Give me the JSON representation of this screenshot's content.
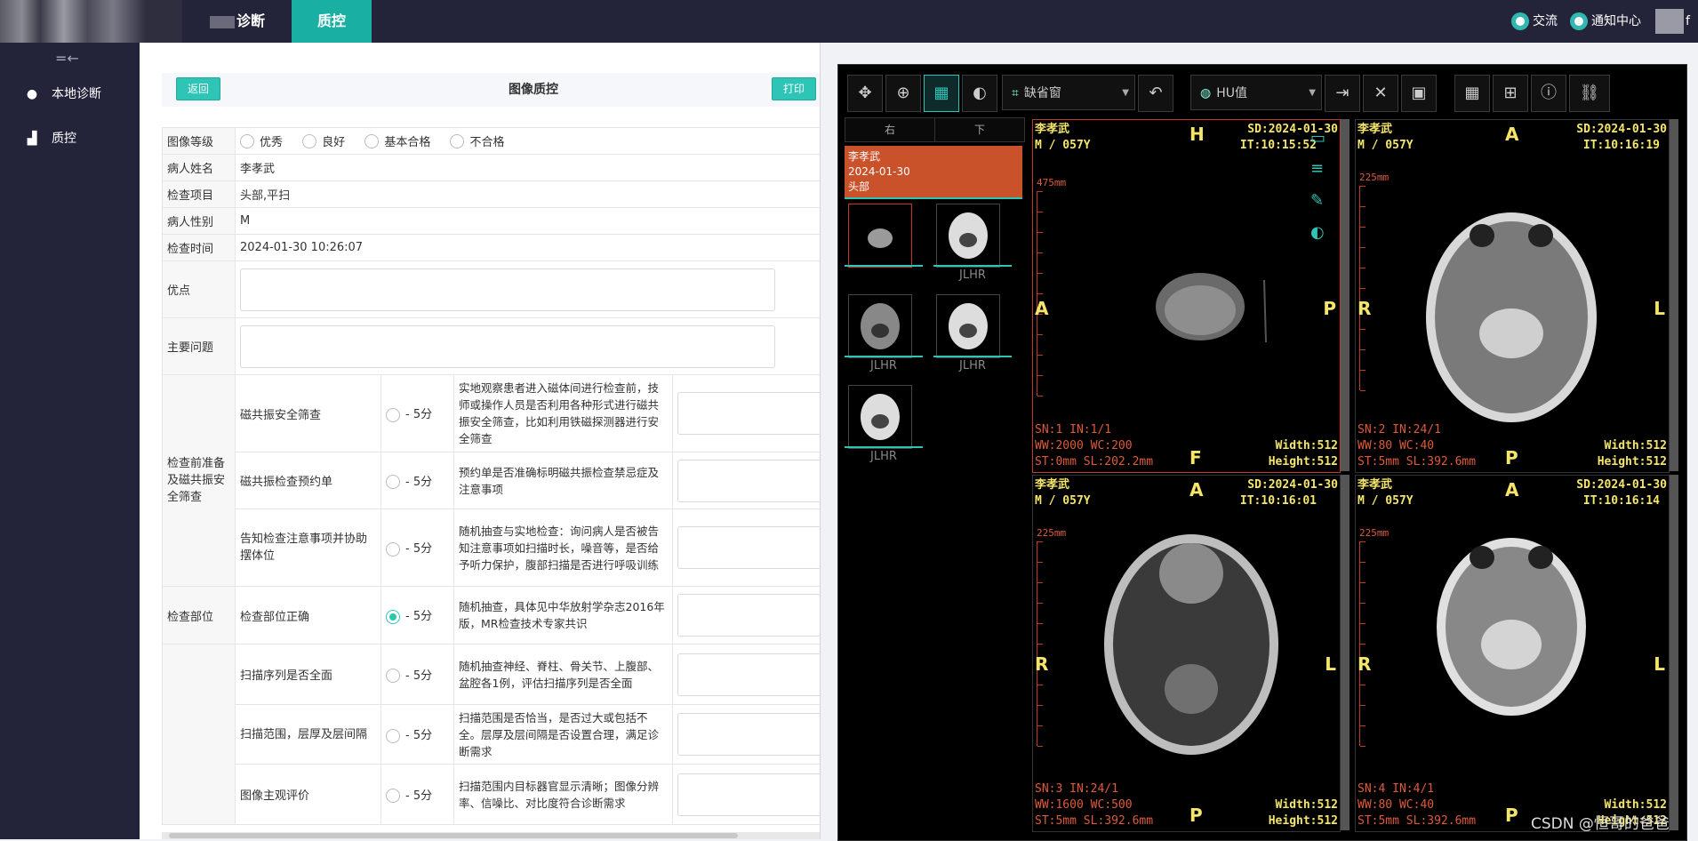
{
  "topbar": {
    "tabs": [
      "诊断",
      "质控"
    ],
    "exchange_label": "交流",
    "notify_label": "通知中心",
    "user_suffix": "f"
  },
  "sidebar": {
    "items": [
      {
        "label": "本地诊断",
        "icon": "user-icon"
      },
      {
        "label": "质控",
        "icon": "sitemap-icon"
      }
    ]
  },
  "form": {
    "title": "图像质控",
    "back_label": "返回",
    "print_label": "打印",
    "grade_label": "图像等级",
    "grade_options": [
      "优秀",
      "良好",
      "基本合格",
      "不合格"
    ],
    "patient_name_label": "病人姓名",
    "patient_name": "李孝武",
    "exam_item_label": "检查项目",
    "exam_item": "头部,平扫",
    "sex_label": "病人性别",
    "sex": "M",
    "exam_time_label": "检查时间",
    "exam_time": "2024-01-30 10:26:07",
    "merit_label": "优点",
    "problem_label": "主要问题",
    "groups": [
      {
        "name": "检查前准备及磁共振安全筛查",
        "rows": [
          {
            "item": "磁共振安全筛查",
            "score": "- 5分",
            "checked": false,
            "desc": "实地观察患者进入磁体间进行检查前，技师或操作人员是否利用各种形式进行磁共振安全筛查，比如利用铁磁探测器进行安全筛查"
          },
          {
            "item": "磁共振检查预约单",
            "score": "- 5分",
            "checked": false,
            "desc": "预约单是否准确标明磁共振检查禁忌症及注意事项"
          },
          {
            "item": "告知检查注意事项并协助摆体位",
            "score": "- 5分",
            "checked": false,
            "desc": "随机抽查与实地检查：询问病人是否被告知注意事项如扫描时长，噪音等，是否给予听力保护，腹部扫描是否进行呼吸训练"
          }
        ]
      },
      {
        "name": "检查部位",
        "rows": [
          {
            "item": "检查部位正确",
            "score": "- 5分",
            "checked": true,
            "desc": "随机抽查，具体见中华放射学杂志2016年版，MR检查技术专家共识"
          }
        ]
      },
      {
        "name": "",
        "rows": [
          {
            "item": "扫描序列是否全面",
            "score": "- 5分",
            "checked": false,
            "desc": "随机抽查神经、脊柱、骨关节、上腹部、盆腔各1例，评估扫描序列是否全面"
          },
          {
            "item": "扫描范围，层厚及层间隔",
            "score": "- 5分",
            "checked": false,
            "desc": "扫描范围是否恰当，是否过大或包括不全。层厚及层间隔是否设置合理，满足诊断需求"
          },
          {
            "item": "图像主观评价",
            "score": "- 5分",
            "checked": false,
            "desc": "扫描范围内目标器官显示清晰；图像分辨率、信噪比、对比度符合诊断需求"
          }
        ]
      }
    ]
  },
  "viewer": {
    "window_select": "缺省窗",
    "hu_select": "HU值",
    "series_tabs": [
      "右",
      "下"
    ],
    "patient_card": {
      "name": "李孝武",
      "date": "2024-01-30",
      "part": "头部"
    },
    "thumb_label": "JLHR",
    "viewports": [
      {
        "name": "李孝武",
        "sexage": "M / 057Y",
        "sd": "SD:2024-01-30",
        "it": "IT:10:15:52",
        "ruler": "475mm",
        "top": "H",
        "bottom": "F",
        "left": "A",
        "right": "P",
        "sn": "SN:1 IN:1/1",
        "ww": "WW:2000 WC:200",
        "st": "ST:0mm SL:202.2mm",
        "width": "Width:512",
        "height": "Height:512"
      },
      {
        "name": "李孝武",
        "sexage": "M / 057Y",
        "sd": "SD:2024-01-30",
        "it": "IT:10:16:19",
        "ruler": "225mm",
        "top": "A",
        "bottom": "P",
        "left": "R",
        "right": "L",
        "sn": "SN:2 IN:24/1",
        "ww": "WW:80 WC:40",
        "st": "ST:5mm SL:392.6mm",
        "width": "Width:512",
        "height": "Height:512"
      },
      {
        "name": "李孝武",
        "sexage": "M / 057Y",
        "sd": "SD:2024-01-30",
        "it": "IT:10:16:01",
        "ruler": "225mm",
        "top": "A",
        "bottom": "P",
        "left": "R",
        "right": "L",
        "sn": "SN:3 IN:24/1",
        "ww": "WW:1600 WC:500",
        "st": "ST:5mm SL:392.6mm",
        "width": "Width:512",
        "height": "Height:512"
      },
      {
        "name": "李孝武",
        "sexage": "M / 057Y",
        "sd": "SD:2024-01-30",
        "it": "IT:10:16:14",
        "ruler": "225mm",
        "top": "A",
        "bottom": "P",
        "left": "R",
        "right": "L",
        "sn": "SN:4 IN:4/1",
        "ww": "WW:80 WC:40",
        "st": "ST:5mm SL:392.6mm",
        "width": "Width:512",
        "height": "Height:512"
      }
    ]
  },
  "watermark": "CSDN @恒哥的爸爸",
  "colors": {
    "accent": "#2ec4b6",
    "topbar": "#23233a",
    "patient_card": "#c9522a",
    "overlay_text": "#f5e66a"
  }
}
